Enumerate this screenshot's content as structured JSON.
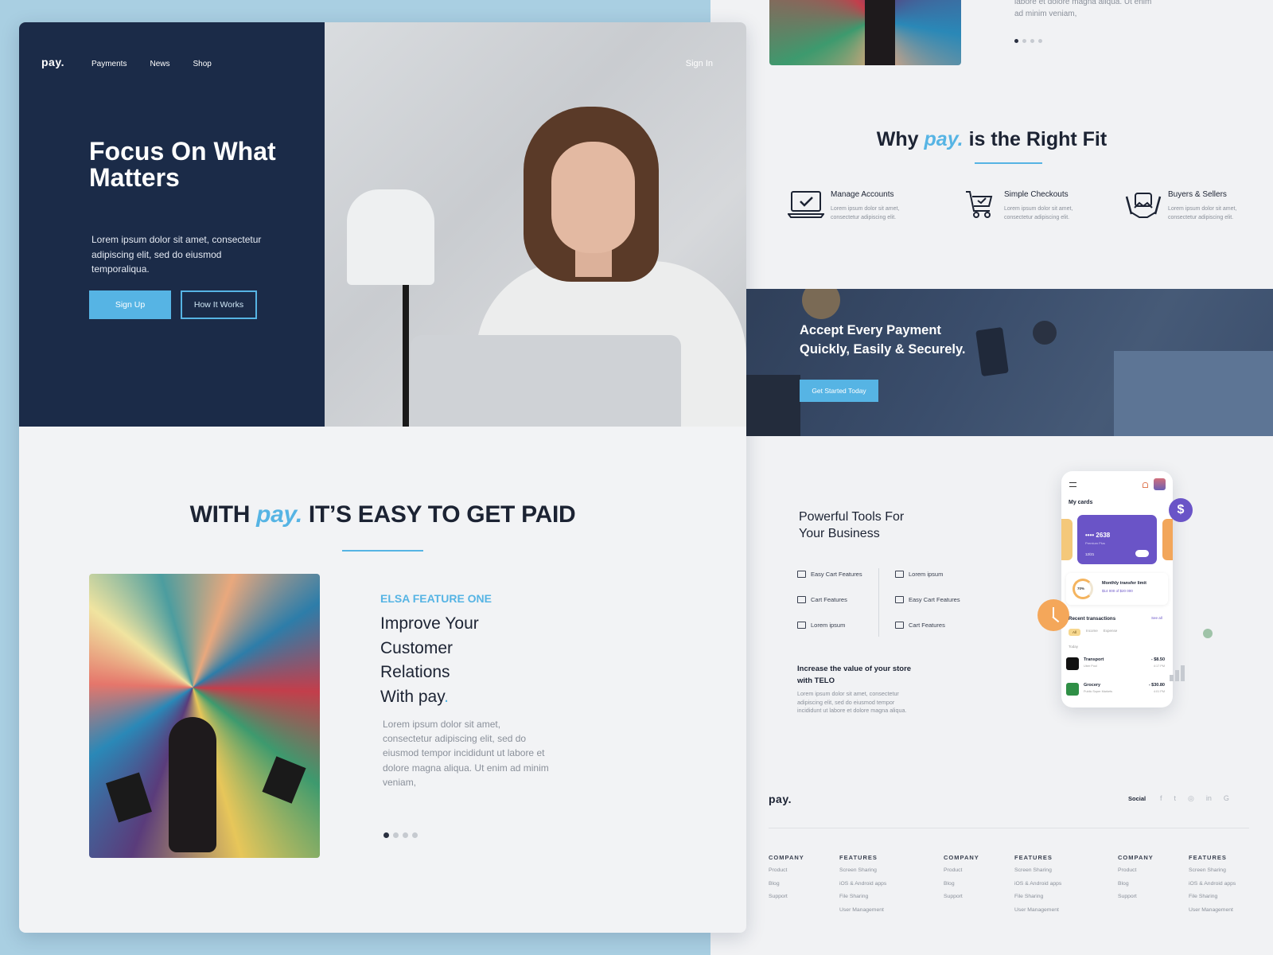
{
  "hero": {
    "logo": "pay.",
    "nav": [
      "Payments",
      "News",
      "Shop"
    ],
    "sign_in": "Sign In",
    "title": "Focus On What Matters",
    "description": "Lorem ipsum dolor sit amet, consectetur adipiscing elit, sed do eiusmod temporaliqua.",
    "signup_label": "Sign Up",
    "how_label": "How It Works"
  },
  "section_paid": {
    "title_pre": "WITH",
    "title_brand": "pay.",
    "title_post": "IT’S EASY TO GET PAID",
    "kicker": "ELSA FEATURE ONE",
    "heading_lines": [
      "Improve Your",
      "Customer",
      "Relations"
    ],
    "heading_last_pre": "With pay",
    "heading_last_dot": ".",
    "body": "Lorem ipsum dolor sit amet, consectetur adipiscing elit, sed do eiusmod tempor incididunt ut labore et dolore magna aliqua. Ut enim ad minim veniam,",
    "carousel_active": 1,
    "carousel_count": 4
  },
  "right_top": {
    "text": "labore et dolore magna aliqua. Ut enim ad minim veniam,"
  },
  "why": {
    "title_pre": "Why",
    "title_brand": "pay.",
    "title_post": "is the Right Fit",
    "items": [
      {
        "name": "Manage Accounts",
        "desc": "Lorem ipsum dolor sit amet, consectetur adipiscing elit.",
        "icon": "laptop-check-icon"
      },
      {
        "name": "Simple Checkouts",
        "desc": "Lorem ipsum dolor sit amet, consectetur adipiscing elit.",
        "icon": "cart-check-icon"
      },
      {
        "name": "Buyers & Sellers",
        "desc": "Lorem ipsum dolor sit amet, consectetur adipiscing elit.",
        "icon": "handshake-icon"
      }
    ]
  },
  "banner": {
    "title_line1": "Accept Every Payment",
    "title_line2": "Quickly, Easily & Securely.",
    "button": "Get Started Today"
  },
  "tools": {
    "title_line1": "Powerful Tools For",
    "title_line2": "Your Business",
    "left": [
      "Easy Cart Features",
      "Cart Features",
      "Lorem ipsum"
    ],
    "right": [
      "Lorem ipsum",
      "Easy Cart Features",
      "Cart Features"
    ],
    "increase_title": "Increase the value of your store with TELO",
    "increase_body": "Lorem ipsum dolor sit amet, consectetur adipiscing elit, sed do eiusmod tempor incididunt ut labore et dolore magna aliqua."
  },
  "phone": {
    "my_cards": "My cards",
    "card_number": "•••• 2638",
    "card_type": "Premium Plus",
    "card_exp": "12/21",
    "limit_pct": "70%",
    "limit_title": "Monthly transfer limit",
    "limit_value": "$14 000  of  $20 000",
    "recent": "Recent transactions",
    "see_all": "See all",
    "filters": [
      "All",
      "Income",
      "Expense"
    ],
    "today": "Today",
    "transactions": [
      {
        "name": "Transport",
        "sub": "Uber Pool",
        "amount": "- $8.50",
        "time": "4:17 PM"
      },
      {
        "name": "Grocery",
        "sub": "Public Super Markets",
        "amount": "- $30.80",
        "time": "4:01 PM"
      }
    ],
    "dollar": "$"
  },
  "footer": {
    "logo": "pay.",
    "social": "Social",
    "social_icons": [
      "f",
      "t",
      "◎",
      "in",
      "G"
    ],
    "columns": [
      {
        "h": "COMPANY",
        "items": [
          "Product",
          "Blog",
          "Support"
        ]
      },
      {
        "h": "FEATURES",
        "items": [
          "Screen Sharing",
          "iOS & Android apps",
          "File Sharing",
          "User Management"
        ]
      },
      {
        "h": "COMPANY",
        "items": [
          "Product",
          "Blog",
          "Support"
        ]
      },
      {
        "h": "FEATURES",
        "items": [
          "Screen Sharing",
          "iOS & Android apps",
          "File Sharing",
          "User Management"
        ]
      },
      {
        "h": "COMPANY",
        "items": [
          "Product",
          "Blog",
          "Support"
        ]
      },
      {
        "h": "FEATURES",
        "items": [
          "Screen Sharing",
          "iOS & Android apps",
          "File Sharing",
          "User Management"
        ]
      }
    ]
  },
  "colors": {
    "navy": "#1b2b48",
    "accent": "#56b4e4",
    "purple": "#6a54c7",
    "orange": "#f4a75a"
  }
}
